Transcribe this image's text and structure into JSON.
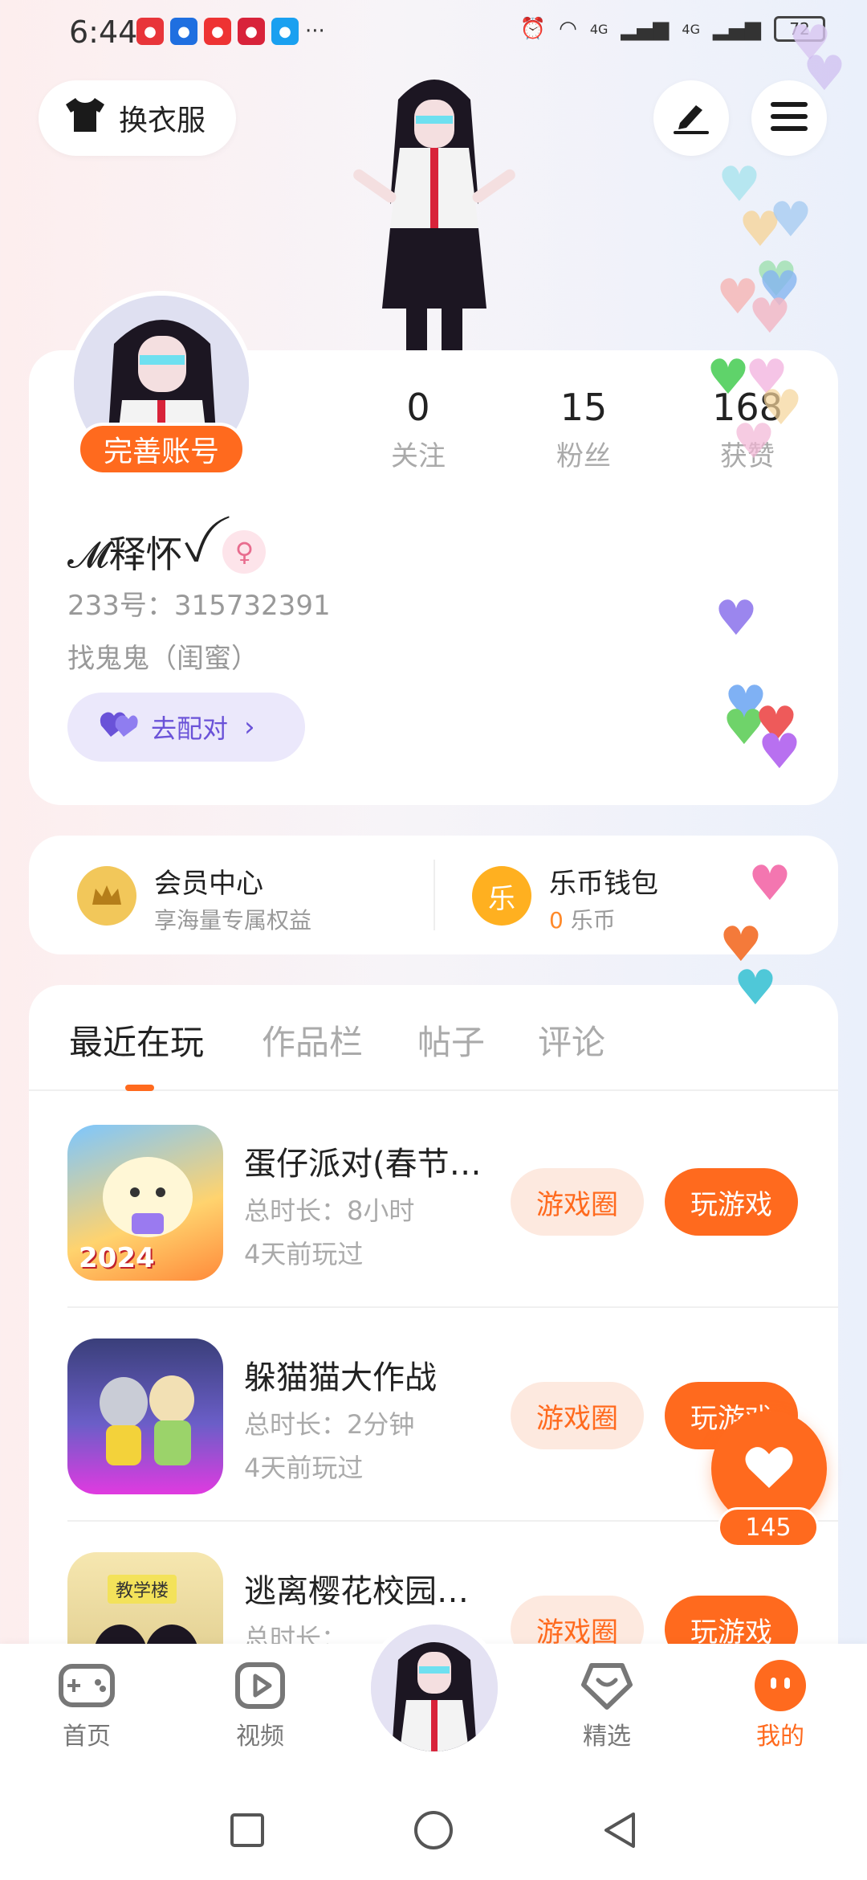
{
  "status_bar": {
    "time": "6:44",
    "more": "···",
    "network_1": "4G",
    "network_2": "4G",
    "battery": "72"
  },
  "header": {
    "outfit_label": "换衣服"
  },
  "profile": {
    "complete_label": "完善账号",
    "stats": [
      {
        "value": "0",
        "label": "关注"
      },
      {
        "value": "15",
        "label": "粉丝"
      },
      {
        "value": "168",
        "label": "获赞"
      }
    ],
    "nickname": "𝓜释怀",
    "nickname_suffix": "ꪜ",
    "uid_line": "233号：315732391",
    "relation_line": "找鬼鬼（闺蜜）",
    "match_label": "去配对"
  },
  "member": {
    "vip_title": "会员中心",
    "vip_sub": "享海量专属权益",
    "wallet_title": "乐币钱包",
    "wallet_icon_text": "乐",
    "wallet_amount": "0",
    "wallet_unit": " 乐币"
  },
  "tabs": [
    "最近在玩",
    "作品栏",
    "帖子",
    "评论"
  ],
  "games": [
    {
      "name": "蛋仔派对(春节…",
      "time": "总时长：8小时",
      "last": "4天前玩过",
      "circle": "游戏圈",
      "play": "玩游戏",
      "thumb_text": "2024"
    },
    {
      "name": "躲猫猫大作战",
      "time": "总时长：2分钟",
      "last": "4天前玩过",
      "circle": "游戏圈",
      "play": "玩游戏",
      "thumb_text": ""
    },
    {
      "name": "逃离樱花校园…",
      "time": "总时长：",
      "last": "",
      "circle": "游戏圈",
      "play": "玩游戏",
      "thumb_text": "教学楼"
    }
  ],
  "float_like": {
    "count": "145"
  },
  "bottom_nav": [
    {
      "label": "首页",
      "icon": "gamepad-icon"
    },
    {
      "label": "视频",
      "icon": "video-icon"
    },
    {
      "label": "精选",
      "icon": "heart-badge-icon"
    },
    {
      "label": "我的",
      "icon": "profile-face-icon"
    }
  ],
  "colors": {
    "accent": "#ff6a1e",
    "match": "#6a52d8"
  }
}
